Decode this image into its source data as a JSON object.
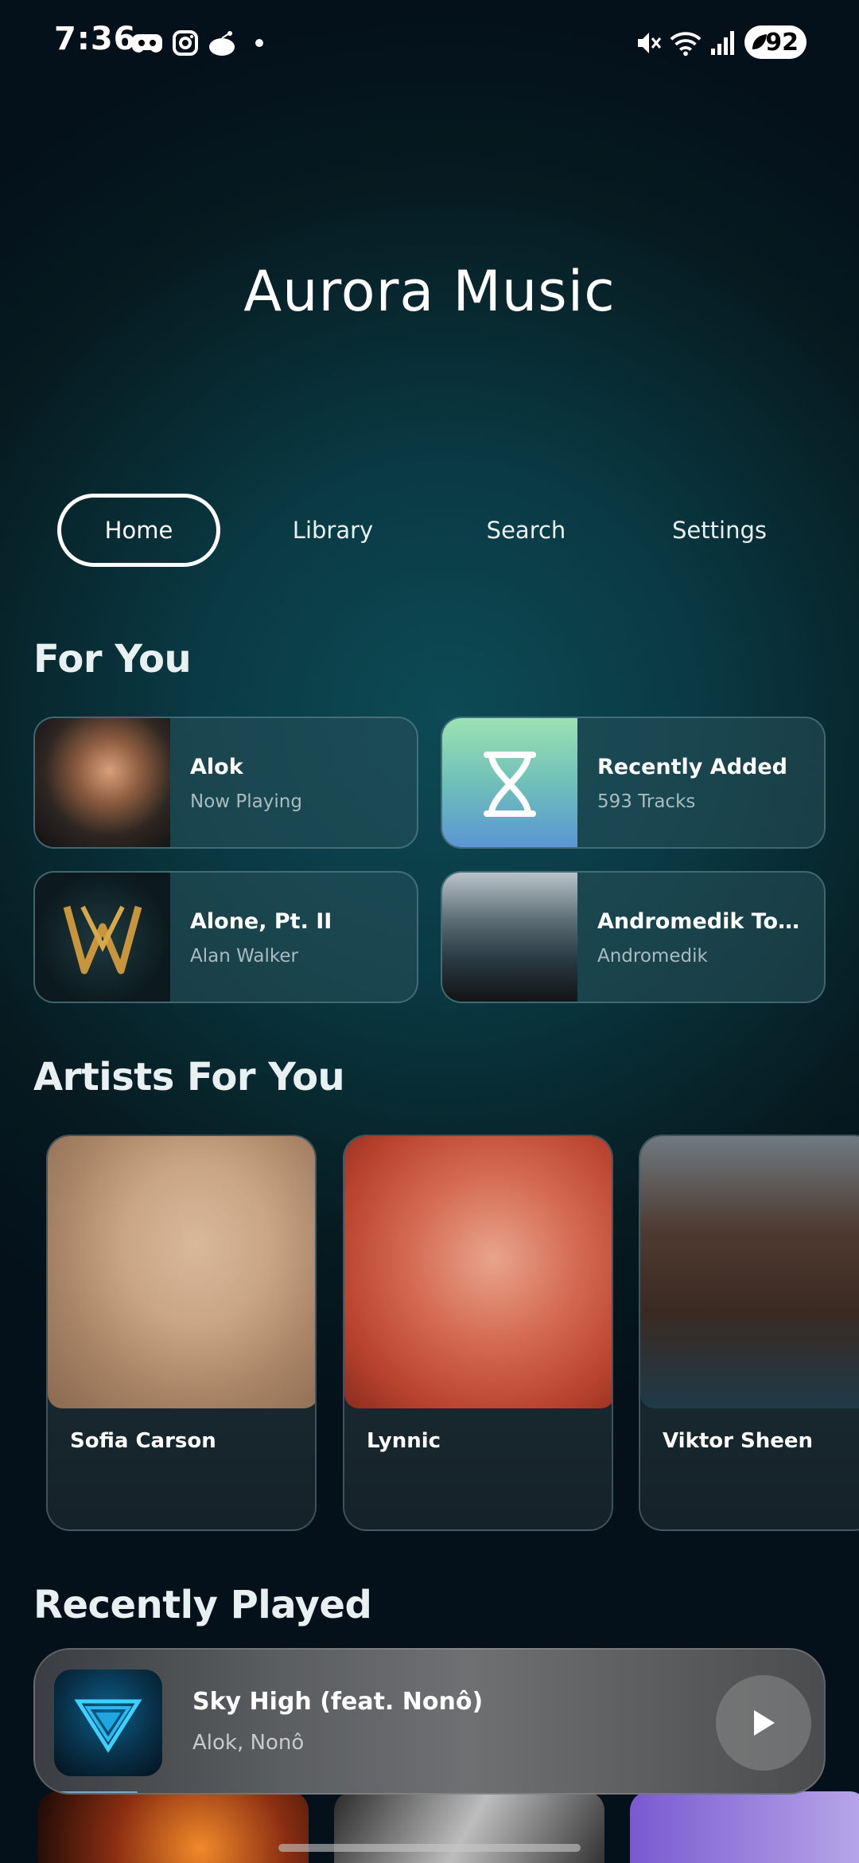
{
  "status_bar": {
    "time": "7:36",
    "battery": "92",
    "left_icons": [
      "game-controller-icon",
      "instagram-icon",
      "reddit-icon",
      "dot-icon"
    ],
    "right_icons": [
      "mute-icon",
      "wifi-icon",
      "signal-icon"
    ]
  },
  "app": {
    "title": "Aurora Music"
  },
  "tabs": [
    {
      "label": "Home",
      "active": true
    },
    {
      "label": "Library",
      "active": false
    },
    {
      "label": "Search",
      "active": false
    },
    {
      "label": "Settings",
      "active": false
    }
  ],
  "for_you": {
    "title": "For You",
    "cards": [
      {
        "title": "Alok",
        "subtitle": "Now Playing"
      },
      {
        "title": "Recently Added",
        "subtitle": "593 Tracks"
      },
      {
        "title": "Alone, Pt. II",
        "subtitle": "Alan Walker"
      },
      {
        "title": "Andromedik Tomo…",
        "subtitle": "Andromedik"
      }
    ]
  },
  "artists": {
    "title": "Artists For You",
    "items": [
      {
        "name": "Sofia Carson"
      },
      {
        "name": "Lynnic"
      },
      {
        "name": "Viktor Sheen"
      }
    ]
  },
  "recently_played": {
    "title": "Recently Played"
  },
  "now_playing": {
    "title": "Sky High (feat. Nonô)",
    "artist": "Alok, Nonô",
    "progress": 0.13
  },
  "colors": {
    "accent": "#7aa6c8",
    "background": "#0a3a44"
  }
}
